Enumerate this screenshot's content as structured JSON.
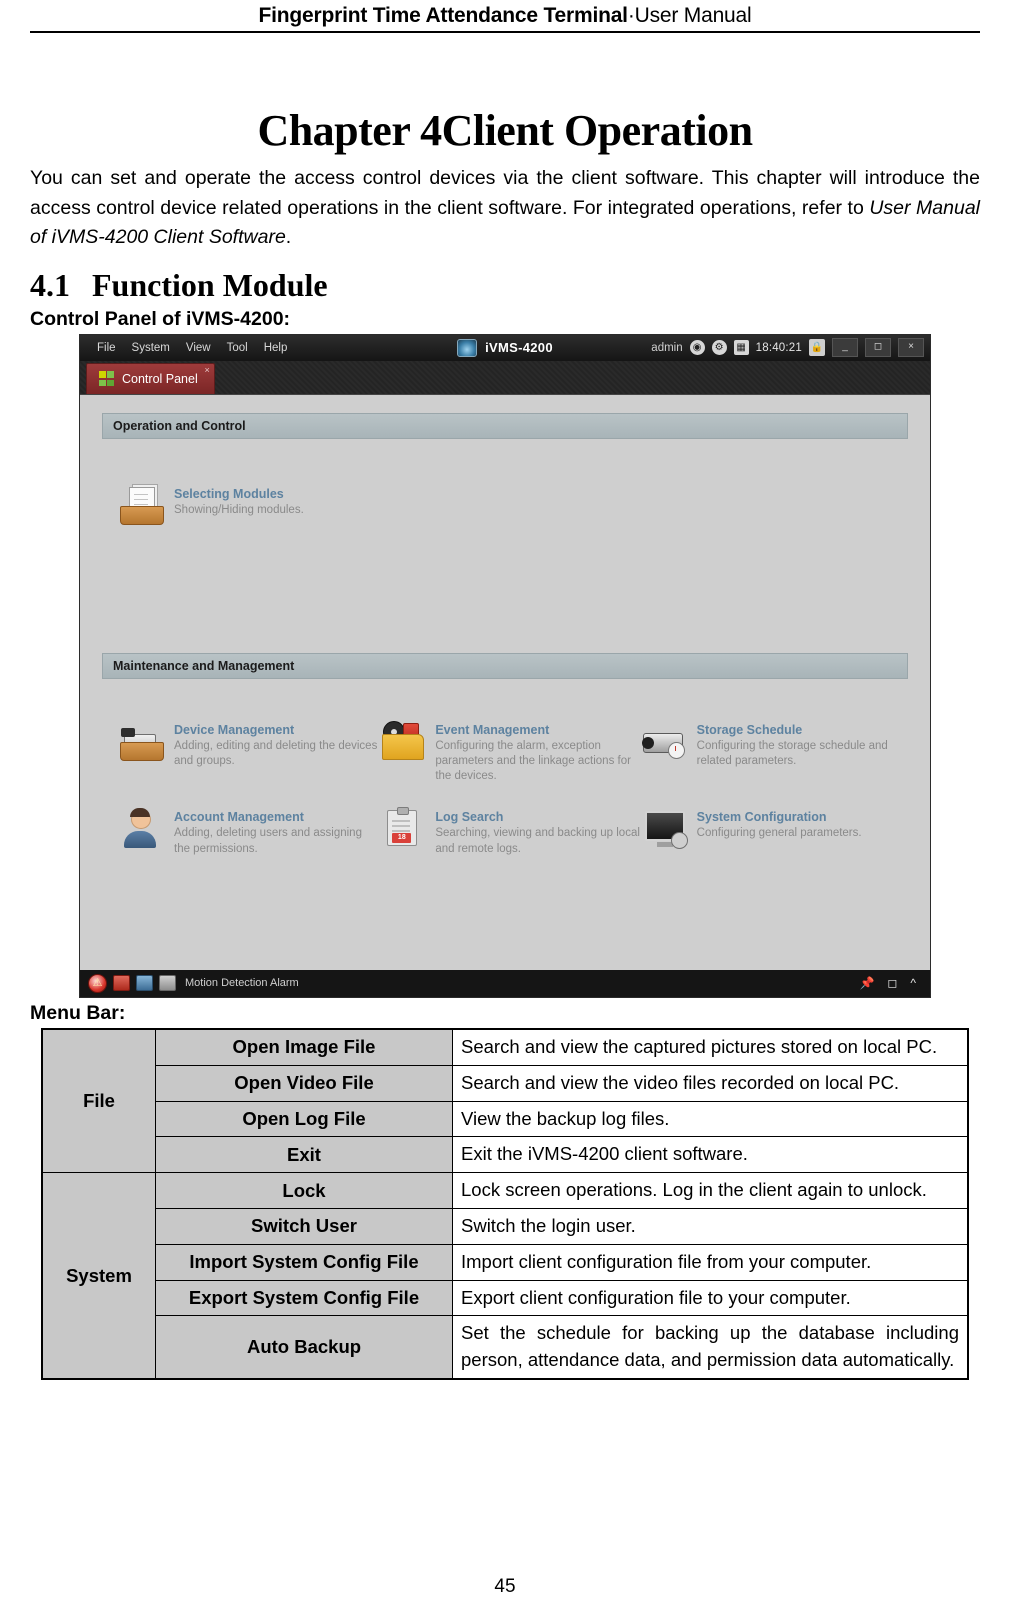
{
  "header": {
    "title_bold": "Fingerprint Time Attendance Terminal",
    "separator": "·",
    "title_light": "User Manual"
  },
  "chapter": {
    "title": "Chapter 4Client Operation",
    "intro_part1": "You can set and operate the access control devices via the client software. This chapter will introduce the access control device related operations in the client software. For integrated operations, refer to ",
    "intro_italic": "User Manual of iVMS-4200 Client Software",
    "intro_end": "."
  },
  "section": {
    "number": "4.1",
    "title": "Function Module",
    "subhead": "Control Panel of iVMS-4200:"
  },
  "app": {
    "menu": [
      "File",
      "System",
      "View",
      "Tool",
      "Help"
    ],
    "app_name": "iVMS-4200",
    "logo_icon": "camera-logo-icon",
    "user": "admin",
    "icons": [
      "globe-icon",
      "gear-icon",
      "calendar-icon"
    ],
    "clock": "18:40:21",
    "lock_icon": "lock-icon",
    "window_buttons": [
      "minimize-button",
      "maximize-button",
      "close-button"
    ],
    "tab": {
      "label": "Control Panel",
      "icon": "grid-icon",
      "close_icon": "close-icon"
    },
    "groups": [
      {
        "title": "Operation and Control",
        "modules": [
          {
            "icon": "selecting-modules-icon",
            "title": "Selecting Modules",
            "desc": "Showing/Hiding modules."
          }
        ]
      },
      {
        "title": "Maintenance and Management",
        "modules": [
          {
            "icon": "device-management-icon",
            "title": "Device Management",
            "desc": "Adding, editing and deleting the devices and groups."
          },
          {
            "icon": "event-management-icon",
            "title": "Event Management",
            "desc": "Configuring the alarm, exception parameters and the linkage actions for the devices."
          },
          {
            "icon": "storage-schedule-icon",
            "title": "Storage Schedule",
            "desc": "Configuring the storage schedule and related parameters."
          },
          {
            "icon": "account-management-icon",
            "title": "Account Management",
            "desc": "Adding, deleting users and assigning the permissions."
          },
          {
            "icon": "log-search-icon",
            "title": "Log Search",
            "desc": "Searching, viewing and backing up local and remote logs."
          },
          {
            "icon": "system-configuration-icon",
            "title": "System Configuration",
            "desc": "Configuring general parameters."
          }
        ]
      }
    ],
    "statusbar": {
      "alarm_icon": "alarm-warning-icon",
      "icons": [
        "alarm-red-icon",
        "alarm-picture-icon",
        "alarm-sound-icon"
      ],
      "text": "Motion Detection Alarm",
      "right_icons": [
        "pin-icon",
        "window-icon",
        "collapse-icon"
      ]
    }
  },
  "menubar": {
    "label": "Menu Bar:",
    "rows": [
      {
        "category": "File",
        "rowspan": 4,
        "items": [
          {
            "name": "Open Image File",
            "desc": "Search and view the captured pictures stored on local PC."
          },
          {
            "name": "Open Video File",
            "desc": "Search and view the video files recorded on local PC."
          },
          {
            "name": "Open Log File",
            "desc": "View the backup log files."
          },
          {
            "name": "Exit",
            "desc": "Exit the iVMS-4200 client software."
          }
        ]
      },
      {
        "category": "System",
        "rowspan": 5,
        "items": [
          {
            "name": "Lock",
            "desc": "Lock screen operations. Log in the client again to unlock."
          },
          {
            "name": "Switch User",
            "desc": "Switch the login user."
          },
          {
            "name": "Import System Config File",
            "desc": "Import client configuration file from your computer."
          },
          {
            "name": "Export System Config File",
            "desc": "Export client configuration file to your computer."
          },
          {
            "name": "Auto Backup",
            "desc": "Set the schedule for backing up the database including person, attendance data, and permission data automatically."
          }
        ]
      }
    ]
  },
  "footer": {
    "page_number": "45"
  }
}
